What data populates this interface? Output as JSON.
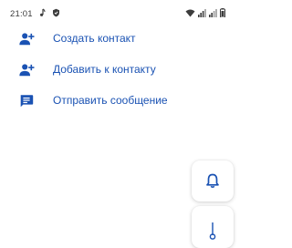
{
  "status_bar": {
    "time": "21:01",
    "icons": [
      "music-note-icon",
      "shield-icon",
      "wifi-icon",
      "signal-icon",
      "signal-icon",
      "battery-icon"
    ]
  },
  "menu": {
    "items": [
      {
        "label": "Создать контакт",
        "icon": "person-add-icon"
      },
      {
        "label": "Добавить к контакту",
        "icon": "person-add-icon"
      },
      {
        "label": "Отправить сообщение",
        "icon": "message-icon"
      }
    ]
  },
  "floating_buttons": [
    {
      "icon": "bell-icon"
    },
    {
      "icon": "pin-icon"
    }
  ],
  "colors": {
    "accent": "#1a52b3",
    "status_text": "#3c3c3c",
    "background": "#ffffff"
  }
}
